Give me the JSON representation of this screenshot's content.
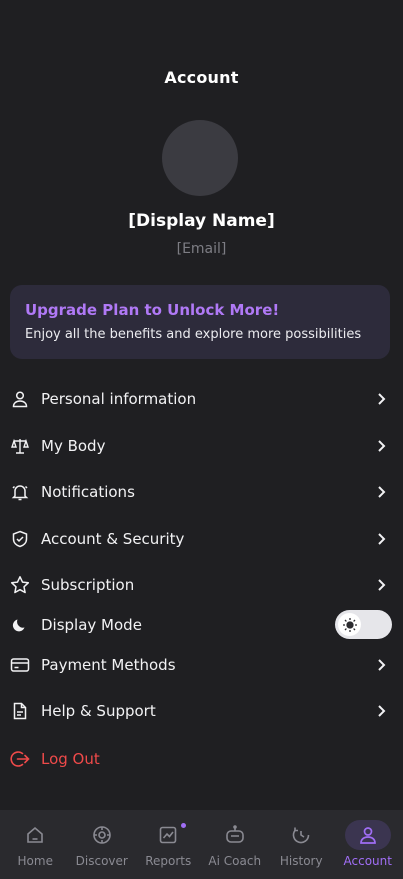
{
  "header": {
    "title": "Account"
  },
  "profile": {
    "display_name": "[Display Name]",
    "email": "[Email]"
  },
  "upgrade": {
    "title": "Upgrade Plan to Unlock More!",
    "subtitle": "Enjoy all the benefits and explore more possibilities"
  },
  "menu": {
    "personal_info": "Personal information",
    "my_body": "My Body",
    "notifications": "Notifications",
    "account_security": "Account & Security",
    "subscription": "Subscription",
    "display_mode": "Display Mode",
    "payment_methods": "Payment Methods",
    "help_support": "Help & Support",
    "log_out": "Log Out"
  },
  "display_mode_toggle": {
    "state": "light"
  },
  "tabs": [
    {
      "label": "Home",
      "icon": "home-icon"
    },
    {
      "label": "Discover",
      "icon": "compass-icon"
    },
    {
      "label": "Reports",
      "icon": "chart-icon"
    },
    {
      "label": "Ai Coach",
      "icon": "robot-icon"
    },
    {
      "label": "History",
      "icon": "history-icon"
    },
    {
      "label": "Account",
      "icon": "user-icon",
      "active": true
    }
  ],
  "colors": {
    "accent": "#a06ef5",
    "danger": "#ef4a4a",
    "background": "#1f1f22"
  }
}
